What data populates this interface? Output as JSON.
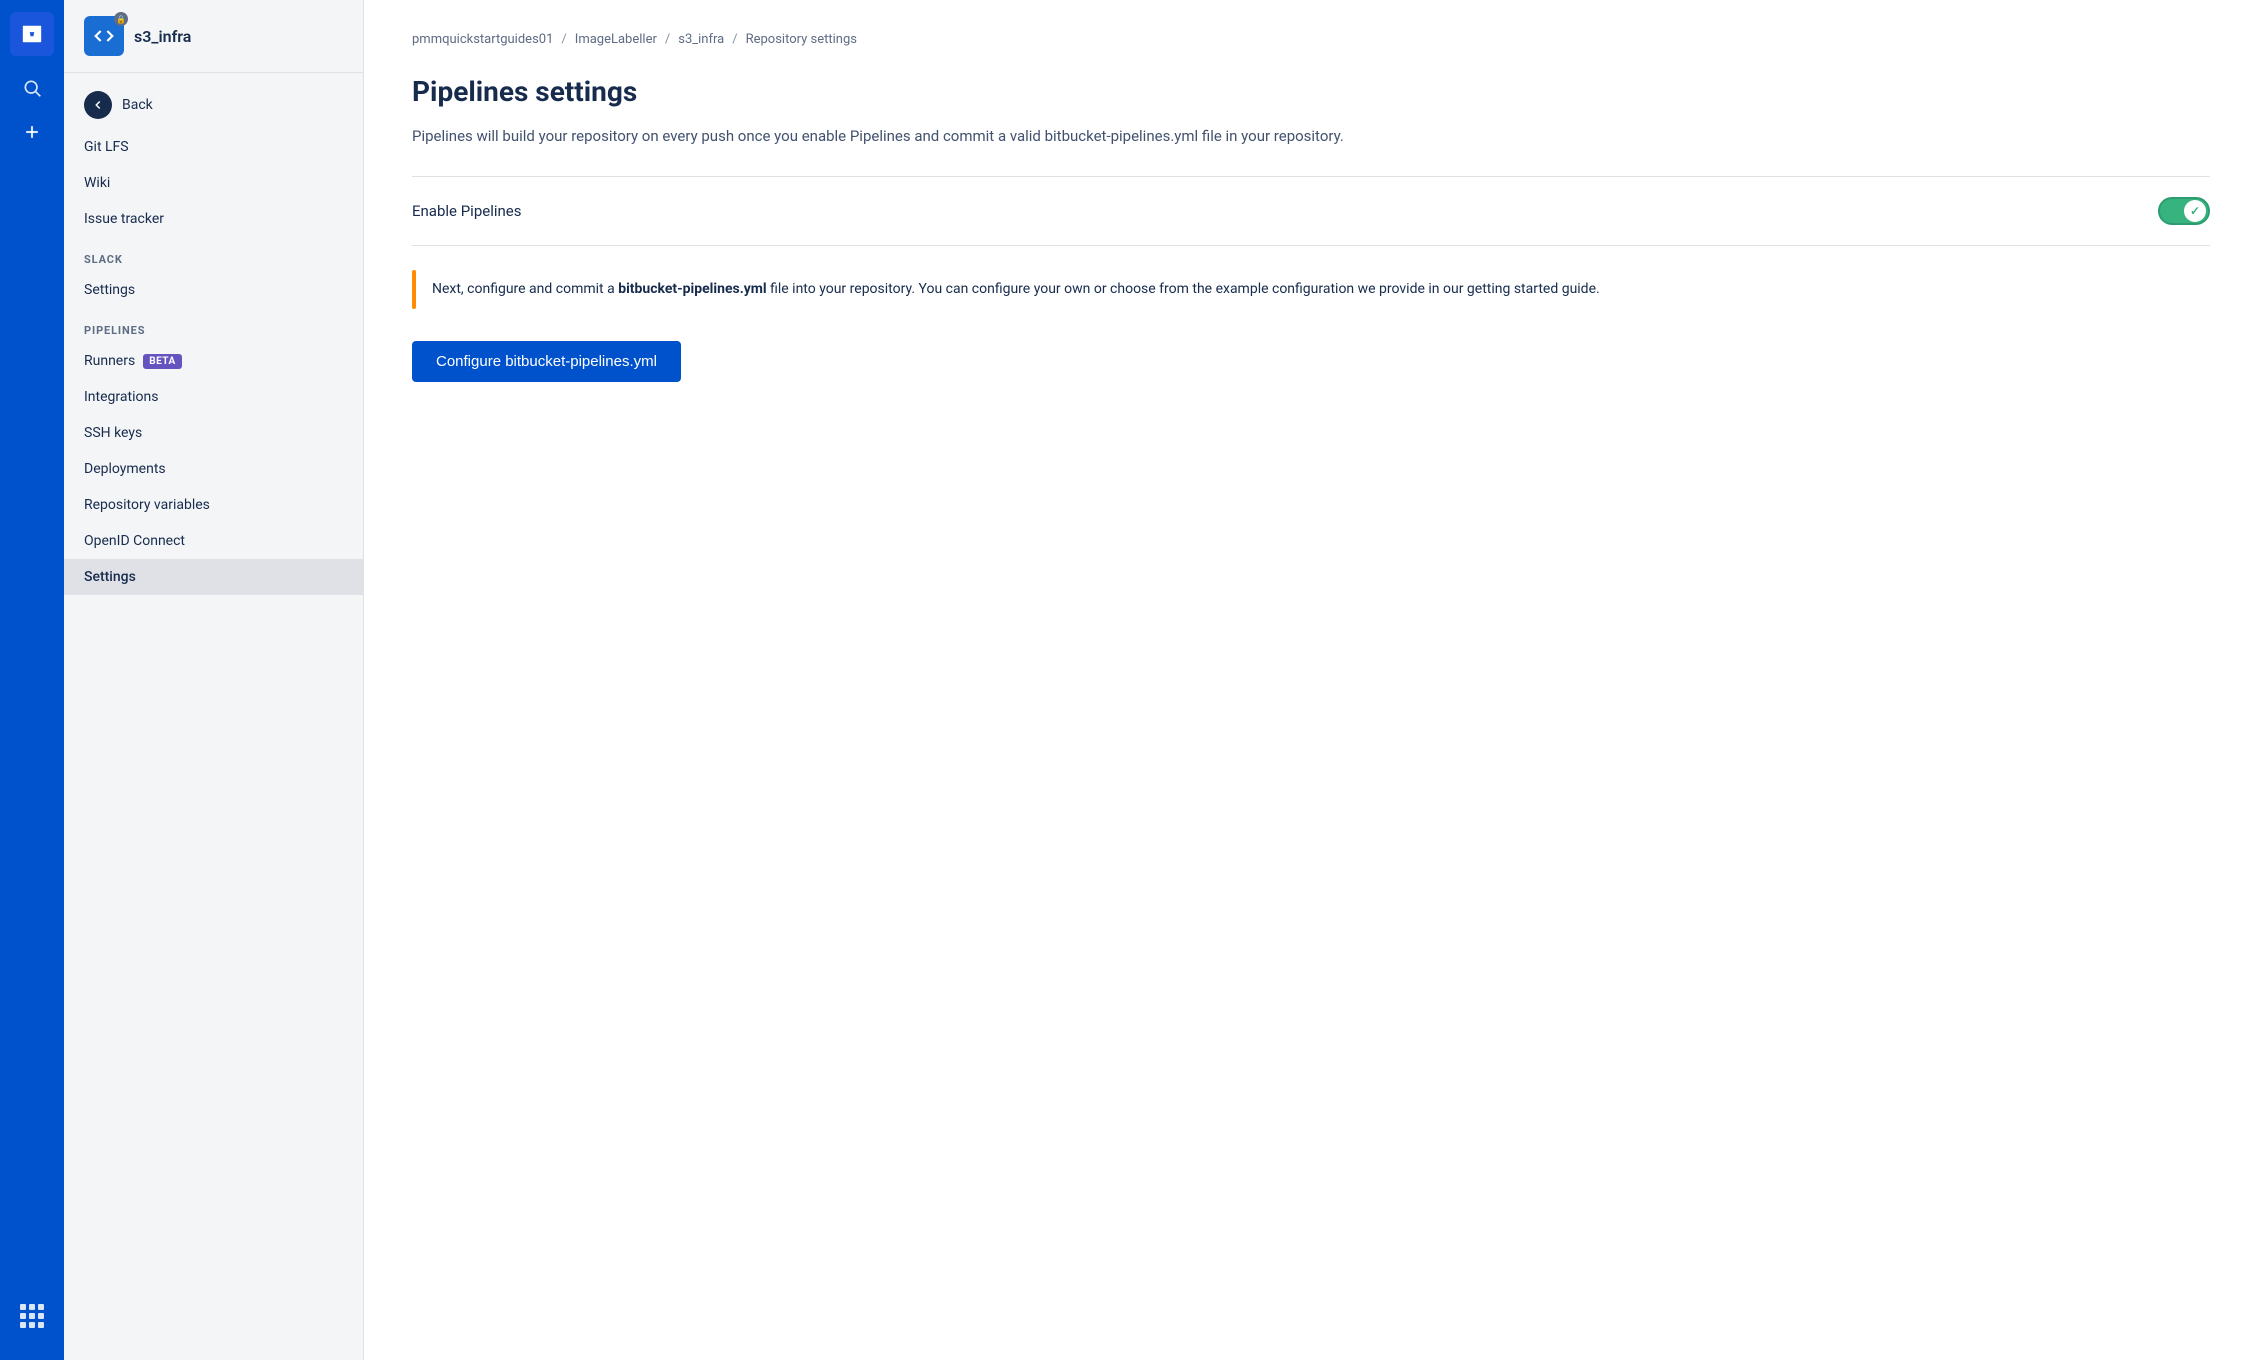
{
  "iconBar": {
    "logoText": "⊞",
    "searchIcon": "🔍",
    "addIcon": "+"
  },
  "sidebar": {
    "repoName": "s3_infra",
    "backLabel": "Back",
    "navItems": [
      {
        "id": "git-lfs",
        "label": "Git LFS",
        "active": false
      },
      {
        "id": "wiki",
        "label": "Wiki",
        "active": false
      },
      {
        "id": "issue-tracker",
        "label": "Issue tracker",
        "active": false
      }
    ],
    "slackSection": {
      "label": "SLACK",
      "items": [
        {
          "id": "slack-settings",
          "label": "Settings",
          "active": false
        }
      ]
    },
    "pipelinesSection": {
      "label": "PIPELINES",
      "items": [
        {
          "id": "runners",
          "label": "Runners",
          "badge": "BETA",
          "active": false
        },
        {
          "id": "integrations",
          "label": "Integrations",
          "active": false
        },
        {
          "id": "ssh-keys",
          "label": "SSH keys",
          "active": false
        },
        {
          "id": "deployments",
          "label": "Deployments",
          "active": false
        },
        {
          "id": "repo-variables",
          "label": "Repository variables",
          "active": false
        },
        {
          "id": "openid-connect",
          "label": "OpenID Connect",
          "active": false
        },
        {
          "id": "settings",
          "label": "Settings",
          "active": true
        }
      ]
    }
  },
  "breadcrumb": {
    "parts": [
      "pmmquickstartguides01",
      "ImageLabeller",
      "s3_infra",
      "Repository settings"
    ],
    "separators": [
      "/",
      "/",
      "/"
    ]
  },
  "main": {
    "title": "Pipelines settings",
    "description": "Pipelines will build your repository on every push once you enable Pipelines and commit a valid bitbucket-pipelines.yml file in your repository.",
    "enablePipelinesLabel": "Enable Pipelines",
    "infoText1": "Next, configure and commit a ",
    "infoFilename": "bitbucket-pipelines.yml",
    "infoText2": " file into your repository. You can configure your own or choose from the example configuration we provide in our getting started guide.",
    "configureButtonLabel": "Configure bitbucket-pipelines.yml"
  }
}
